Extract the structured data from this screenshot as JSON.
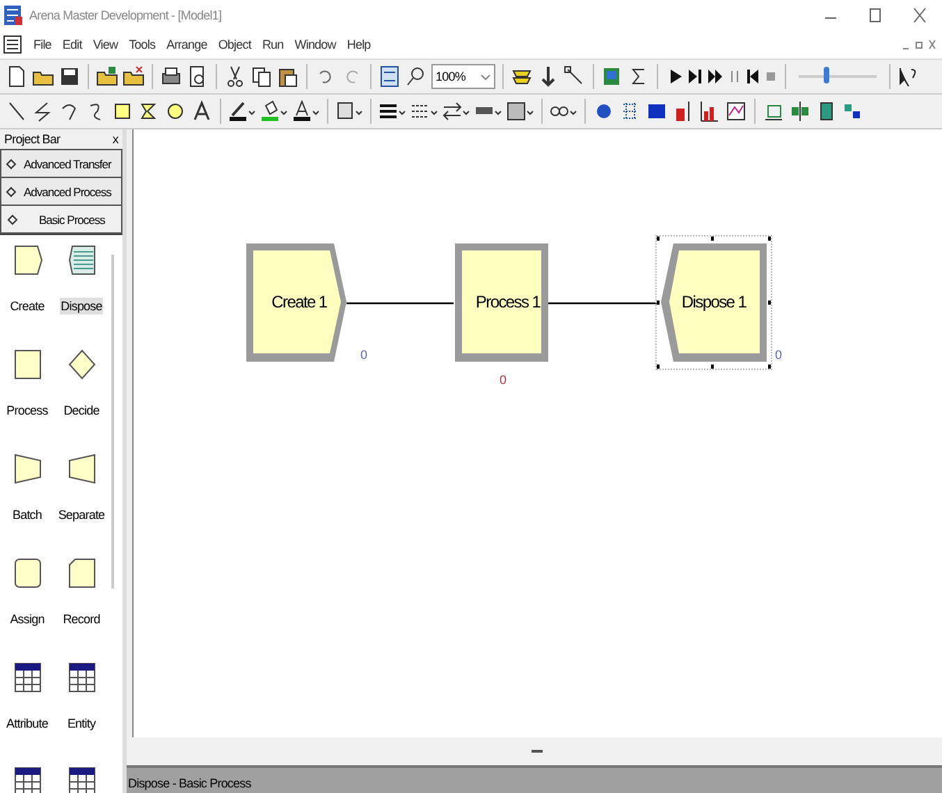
{
  "window": {
    "title": "Arena Master Development - [Model1]"
  },
  "menu": [
    "File",
    "Edit",
    "View",
    "Tools",
    "Arrange",
    "Object",
    "Run",
    "Window",
    "Help"
  ],
  "toolbar": {
    "zoom": "100%",
    "speed": {
      "level": 0.35
    }
  },
  "project_bar": {
    "title": "Project Bar",
    "close": "x",
    "panels": [
      {
        "label": "Advanced Transfer",
        "selected": false
      },
      {
        "label": "Advanced Process",
        "selected": false
      },
      {
        "label": "Basic Process",
        "selected": true
      }
    ],
    "modules": [
      {
        "kind": "create",
        "label": "Create",
        "selected": false
      },
      {
        "kind": "dispose",
        "label": "Dispose",
        "selected": true
      },
      {
        "kind": "process",
        "label": "Process",
        "selected": false
      },
      {
        "kind": "decide",
        "label": "Decide",
        "selected": false
      },
      {
        "kind": "batch",
        "label": "Batch",
        "selected": false
      },
      {
        "kind": "separate",
        "label": "Separate",
        "selected": false
      },
      {
        "kind": "assign",
        "label": "Assign",
        "selected": false
      },
      {
        "kind": "record",
        "label": "Record",
        "selected": false
      },
      {
        "kind": "table",
        "label": "Attribute",
        "selected": false
      },
      {
        "kind": "table",
        "label": "Entity",
        "selected": false
      },
      {
        "kind": "table",
        "selected": false
      },
      {
        "kind": "table",
        "selected": false
      }
    ]
  },
  "canvas": {
    "modules": [
      {
        "kind": "create",
        "label": "Create 1",
        "counter": "0",
        "selected": false
      },
      {
        "kind": "process",
        "label": "Process 1",
        "counter": "0",
        "selected": false
      },
      {
        "kind": "dispose",
        "label": "Dispose 1",
        "counter": "0",
        "selected": true
      }
    ]
  },
  "status_bar": "Dispose - Basic Process"
}
